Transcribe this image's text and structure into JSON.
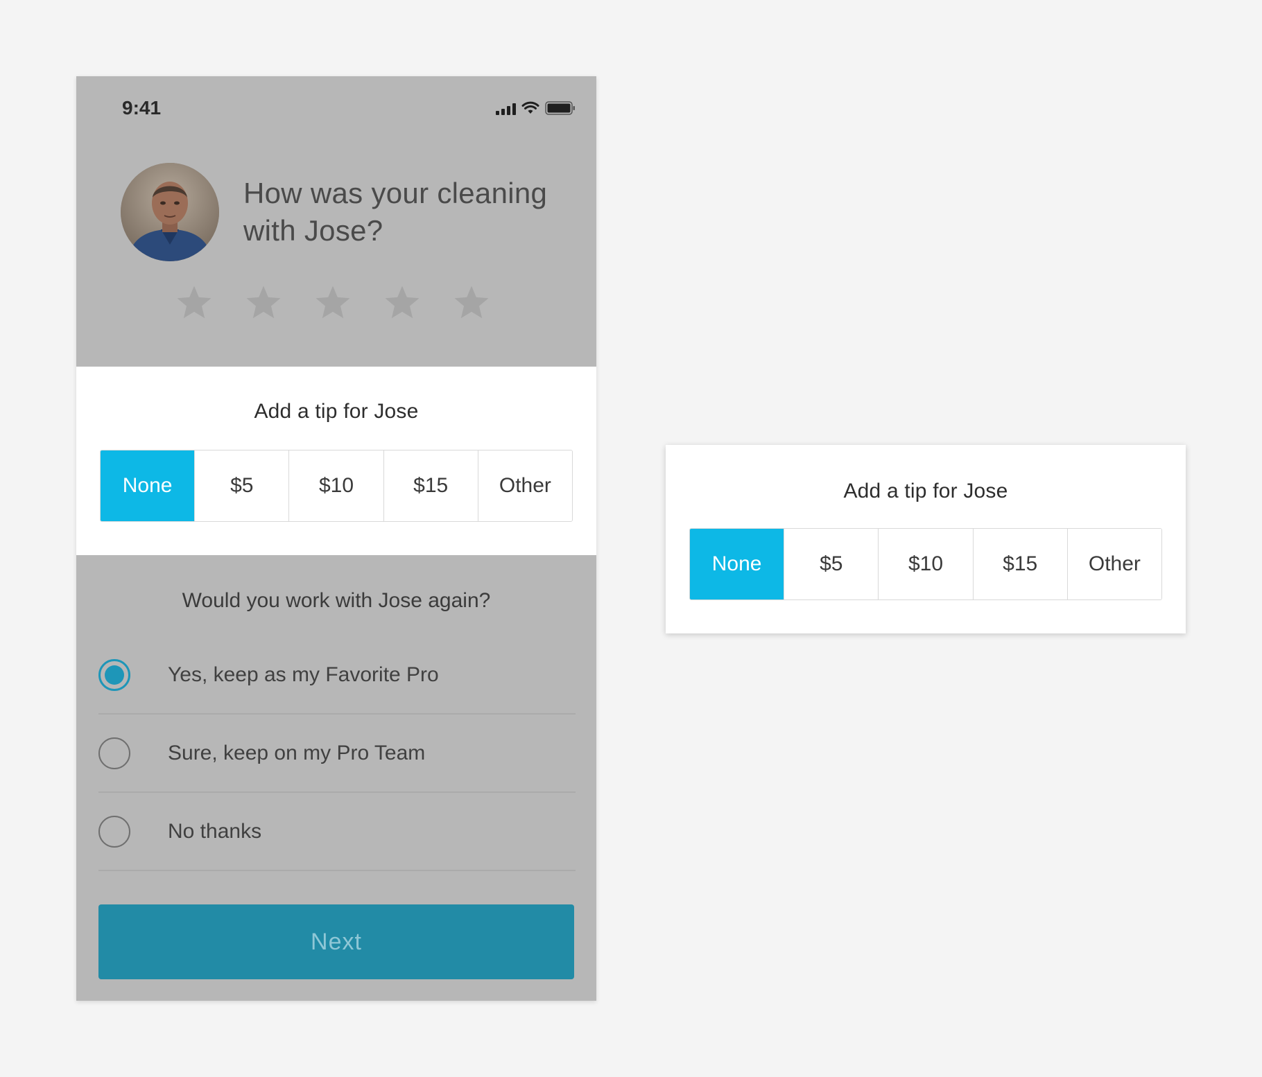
{
  "status_bar": {
    "time": "9:41"
  },
  "rating": {
    "question": "How was your cleaning with Jose?",
    "stars": 5,
    "selected_stars": 0
  },
  "tip": {
    "title": "Add a tip for Jose",
    "options": [
      "None",
      "$5",
      "$10",
      "$15",
      "Other"
    ],
    "selected": "None"
  },
  "rehire": {
    "question": "Would you work with Jose again?",
    "options": [
      {
        "label": "Yes, keep as my Favorite Pro",
        "checked": true
      },
      {
        "label": "Sure, keep on my Pro Team",
        "checked": false
      },
      {
        "label": "No thanks",
        "checked": false
      }
    ]
  },
  "next_label": "Next",
  "colors": {
    "accent": "#0db8e6",
    "button": "#228ba6",
    "overlay": "#b7b7b7"
  }
}
